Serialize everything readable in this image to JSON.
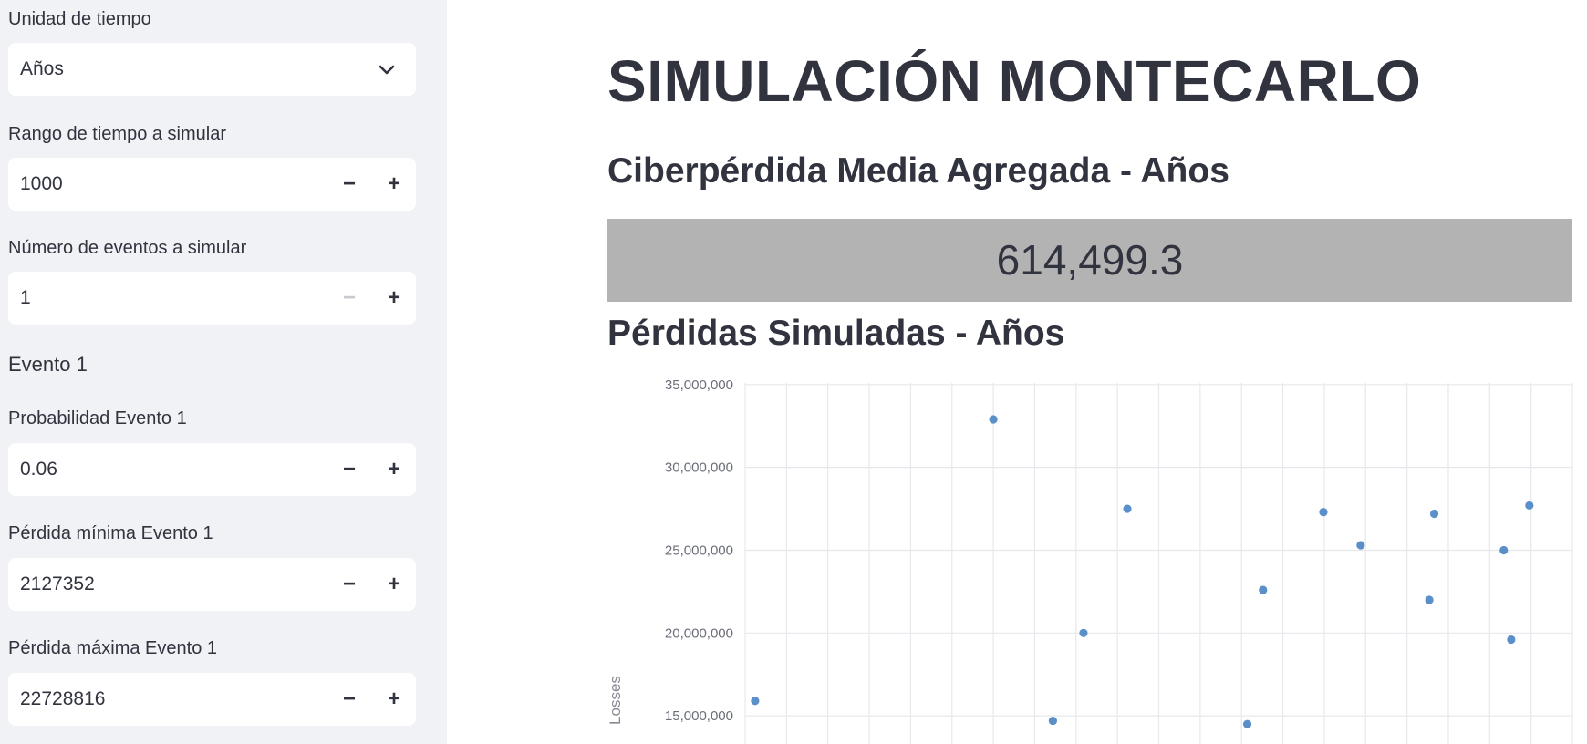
{
  "sidebar": {
    "time_unit": {
      "label": "Unidad de tiempo",
      "value": "Años"
    },
    "time_range": {
      "label": "Rango de tiempo a simular",
      "value": "1000"
    },
    "num_events": {
      "label": "Número de eventos a simular",
      "value": "1"
    },
    "event_header": "Evento 1",
    "probability": {
      "label": "Probabilidad Evento 1",
      "value": "0.06"
    },
    "min_loss": {
      "label": "Pérdida mínima Evento 1",
      "value": "2127352"
    },
    "max_loss": {
      "label": "Pérdida máxima Evento 1",
      "value": "22728816"
    },
    "minus_symbol": "−",
    "plus_symbol": "+"
  },
  "main": {
    "title": "SIMULACIÓN MONTECARLO",
    "metric_heading": "Ciberpérdida Media Agregada - Años",
    "metric_value": "614,499.3",
    "chart_heading": "Pérdidas Simuladas - Años"
  },
  "chart_data": {
    "type": "scatter",
    "ylabel": "Losses",
    "ylim": [
      13300000,
      35100000
    ],
    "xlim": [
      0,
      1000
    ],
    "yticks": [
      15000000,
      20000000,
      25000000,
      30000000,
      35000000
    ],
    "ytick_labels": [
      "15,000,000",
      "20,000,000",
      "25,000,000",
      "30,000,000",
      "35,000,000"
    ],
    "grid": true,
    "color": "#5b8fc9",
    "points": [
      {
        "x": 12,
        "y": 15900000
      },
      {
        "x": 300,
        "y": 32900000
      },
      {
        "x": 372,
        "y": 14700000
      },
      {
        "x": 409,
        "y": 20000000
      },
      {
        "x": 462,
        "y": 27500000
      },
      {
        "x": 607,
        "y": 14500000
      },
      {
        "x": 626,
        "y": 22600000
      },
      {
        "x": 699,
        "y": 27300000
      },
      {
        "x": 744,
        "y": 25300000
      },
      {
        "x": 827,
        "y": 22000000
      },
      {
        "x": 833,
        "y": 27200000
      },
      {
        "x": 917,
        "y": 25000000
      },
      {
        "x": 926,
        "y": 19600000
      },
      {
        "x": 948,
        "y": 27700000
      }
    ]
  }
}
